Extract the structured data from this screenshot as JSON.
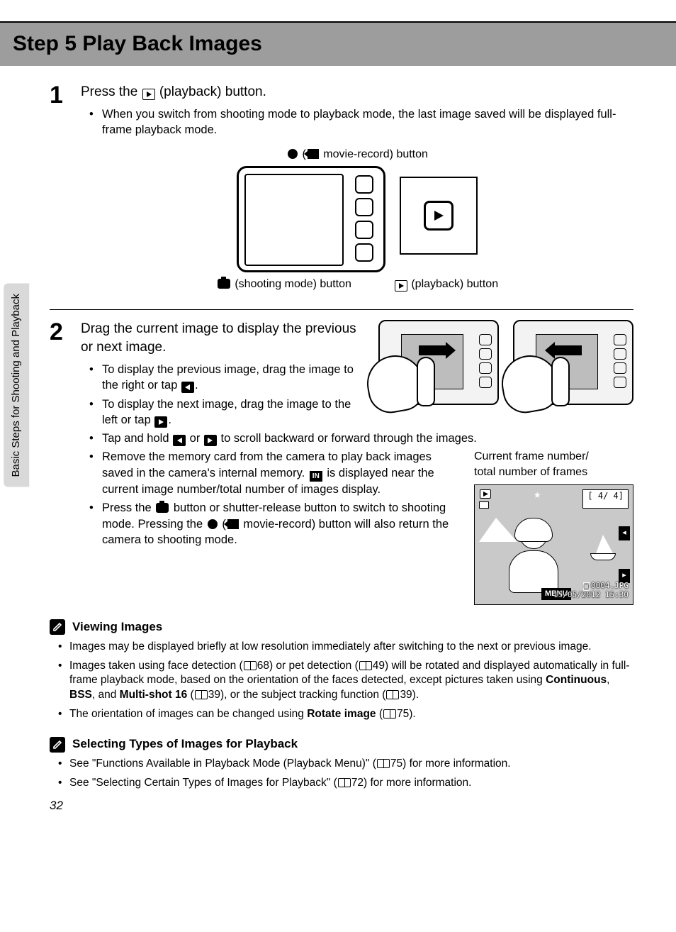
{
  "sidetab": "Basic Steps for Shooting and Playback",
  "title": "Step 5 Play Back Images",
  "page_number": "32",
  "step1": {
    "num": "1",
    "title_pre": "Press the ",
    "title_post": " (playback) button.",
    "bullet1": "When you switch from shooting mode to playback mode, the last image saved will be displayed full-frame playback mode.",
    "movie_btn_label_pre": "(",
    "movie_btn_label_post": " movie-record) button",
    "shoot_label": " (shooting mode) button",
    "play_label": " (playback) button"
  },
  "step2": {
    "num": "2",
    "title": "Drag the current image to display the previous or next image.",
    "b1": "To display the previous image, drag the image to the right or tap ",
    "b1_end": ".",
    "b2": "To display the next image, drag the image to the left or tap ",
    "b2_end": ".",
    "b3_a": "Tap and hold ",
    "b3_mid": " or ",
    "b3_b": " to scroll backward or forward through the images.",
    "b4_a": "Remove the memory card from the camera to play back images saved in the camera's internal memory. ",
    "b4_b": " is displayed near the current image number/total number of images display.",
    "b5_a": "Press the ",
    "b5_b": " button or shutter-release button to switch to shooting mode. Pressing the ",
    "b5_c": " (",
    "b5_d": " movie-record) button will also return the camera to shooting mode."
  },
  "frame_label": "Current frame number/\ntotal number of frames",
  "frame_count": "[   4/   4]",
  "frame_file": "0004.JPG",
  "frame_date": "15/05/2012 15:30",
  "frame_menu": "MENU",
  "note1": {
    "title": "Viewing Images",
    "b1": "Images may be displayed briefly at low resolution immediately after switching to the next or previous image.",
    "b2_a": "Images taken using face detection (",
    "b2_b": "68) or pet detection (",
    "b2_c": "49) will be rotated and displayed automatically in full-frame playback mode, based on the orientation of the faces detected, except pictures taken using ",
    "b2_d": ", ",
    "b2_e": ", and ",
    "b2_f": " (",
    "b2_g": "39), or the subject tracking function (",
    "b2_h": "39).",
    "cont": "Continuous",
    "bss": "BSS",
    "ms16": "Multi-shot 16",
    "b3_a": "The orientation of images can be changed using ",
    "b3_b": " (",
    "b3_c": "75).",
    "rotate": "Rotate image"
  },
  "note2": {
    "title": "Selecting Types of Images for Playback",
    "b1_a": "See \"Functions Available in Playback Mode (Playback Menu)\" (",
    "b1_b": "75) for more information.",
    "b2_a": "See \"Selecting Certain Types of Images for Playback\" (",
    "b2_b": "72) for more information."
  }
}
